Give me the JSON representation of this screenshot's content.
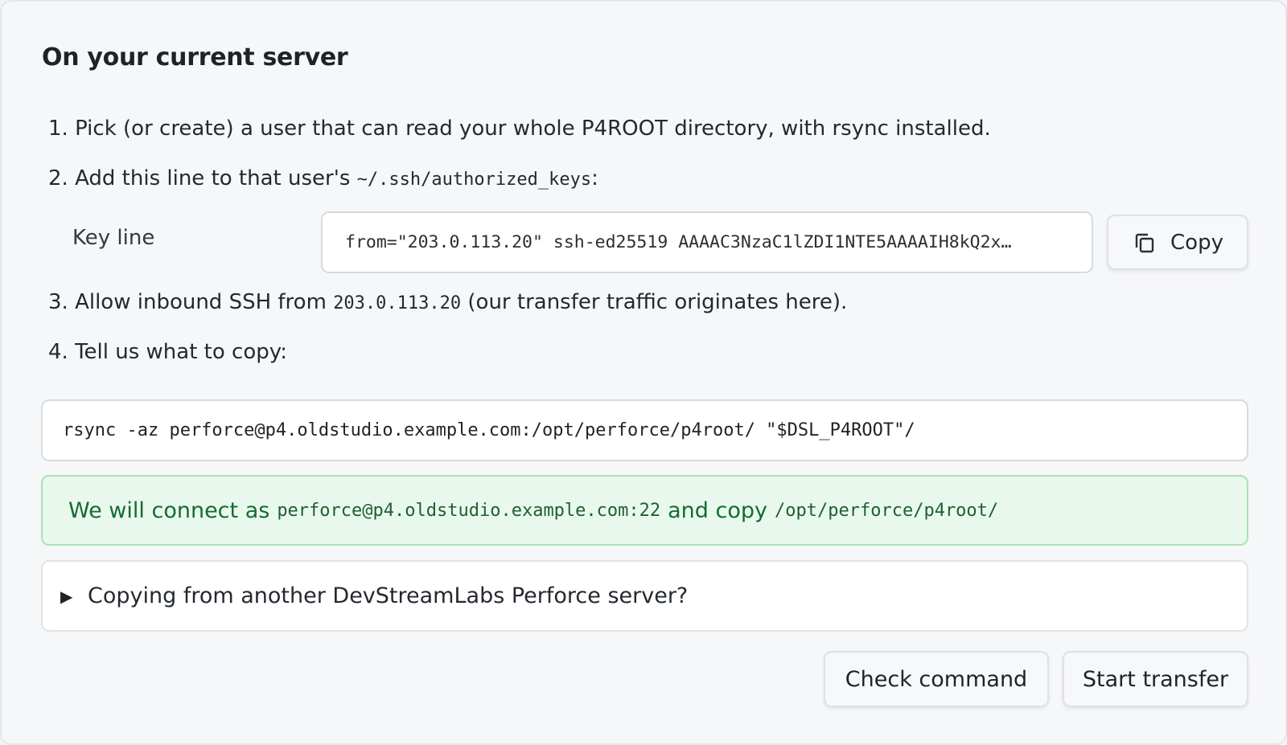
{
  "section": {
    "title": "On your current server"
  },
  "steps": {
    "s1": {
      "text": "1. Pick (or create) a user that can read your whole P4ROOT directory, with rsync installed."
    },
    "s2": {
      "prefix": "2. Add this line to that user's ",
      "code": "~/.ssh/authorized_keys",
      "suffix": ":"
    },
    "s3": {
      "prefix": "3. Allow inbound SSH from ",
      "code": "203.0.113.20",
      "suffix": " (our transfer traffic originates here)."
    },
    "s4": {
      "text": "4. Tell us what to copy:"
    }
  },
  "key_line": {
    "label": "Key line",
    "value": "from=\"203.0.113.20\" ssh-ed25519 AAAAC3NzaC1lZDI1NTE5AAAAIH8kQ2x…",
    "copy_label": "Copy",
    "copy_icon": "copy-icon"
  },
  "command": {
    "value": "rsync -az perforce@p4.oldstudio.example.com:/opt/perforce/p4root/ \"$DSL_P4ROOT\"/"
  },
  "notice": {
    "prefix": "We will connect as",
    "host": "perforce@p4.oldstudio.example.com:22",
    "middle": "and copy",
    "path": "/opt/perforce/p4root/",
    "color": "#166a34",
    "background": "#e9f8ec"
  },
  "details": {
    "summary": "Copying from another DevStreamLabs Perforce server?",
    "icon": "disclosure-triangle-icon"
  },
  "actions": {
    "check_label": "Check command",
    "start_label": "Start transfer"
  }
}
